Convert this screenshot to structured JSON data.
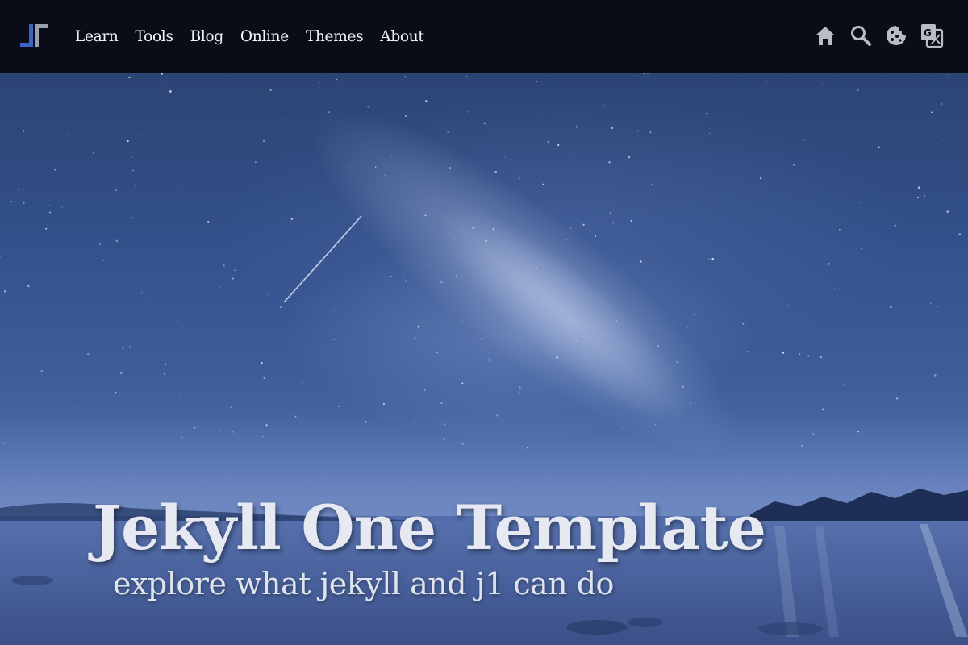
{
  "navbar": {
    "brand_icon": "j1-logo-icon",
    "menu": [
      "Learn",
      "Tools",
      "Blog",
      "Online",
      "Themes",
      "About"
    ],
    "icons": [
      "home-icon",
      "search-icon",
      "cookie-icon",
      "translate-icon"
    ]
  },
  "hero": {
    "title": "Jekyll One Template",
    "tagline": "explore what jekyll and j1 can do"
  },
  "colors": {
    "navbar_bg": "#0a0d17",
    "nav_text": "#f2f4f8",
    "icon_gray": "#b9bcc4",
    "hero_blue": "#3e5e9c",
    "title_text": "#e6e9f2"
  }
}
